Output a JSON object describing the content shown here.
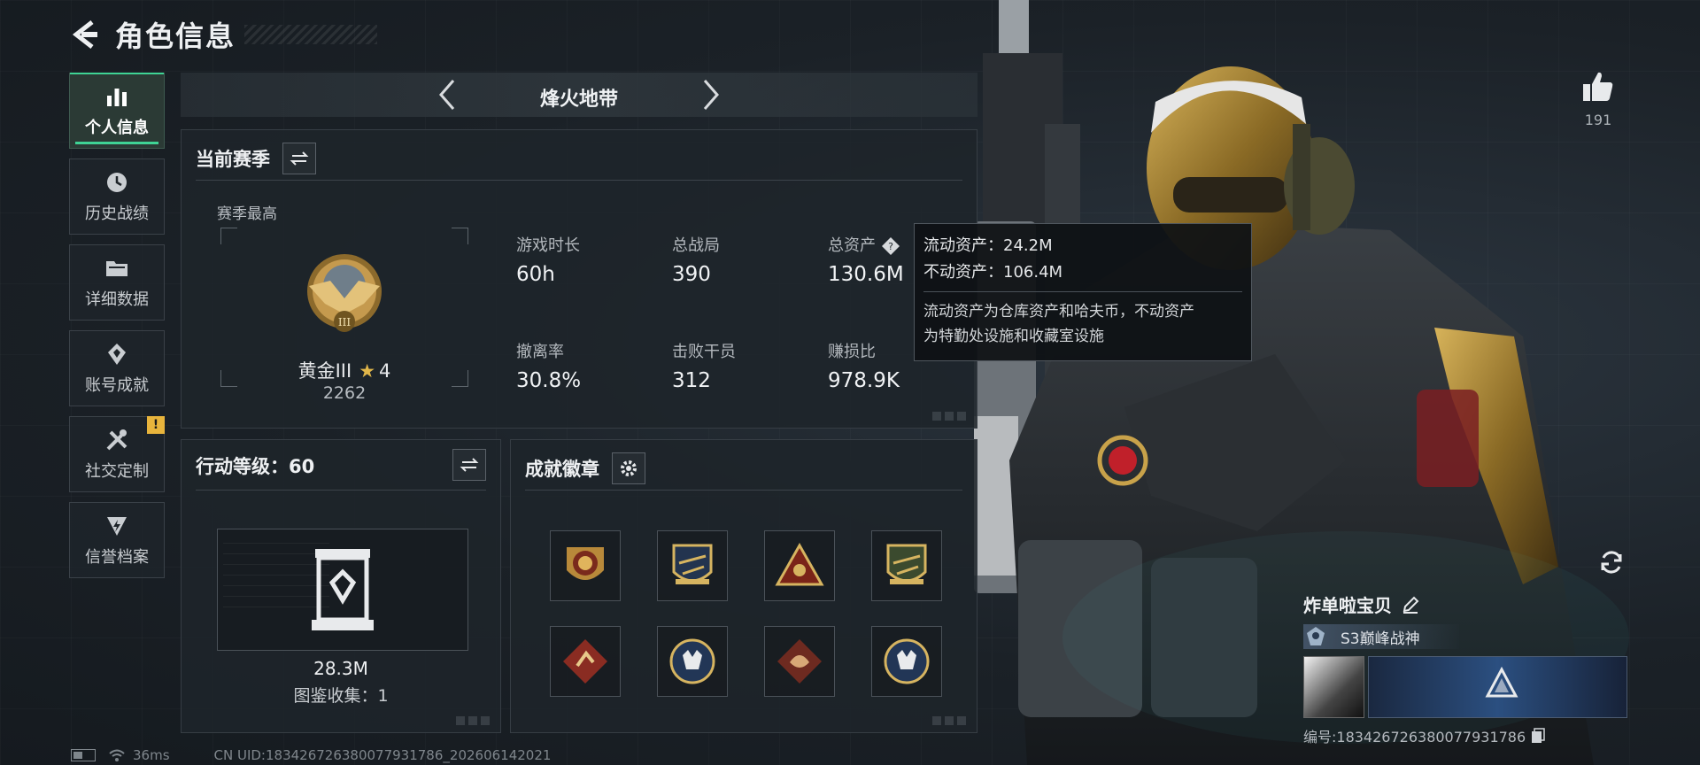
{
  "header": {
    "title": "角色信息"
  },
  "sidebar": {
    "items": [
      {
        "label": "个人信息",
        "icon": "bar-chart-icon",
        "active": true
      },
      {
        "label": "历史战绩",
        "icon": "history-icon"
      },
      {
        "label": "详细数据",
        "icon": "folder-icon"
      },
      {
        "label": "账号成就",
        "icon": "achievement-icon"
      },
      {
        "label": "社交定制",
        "icon": "tools-icon",
        "badge": "!"
      },
      {
        "label": "信誉档案",
        "icon": "credit-icon"
      }
    ]
  },
  "mode": {
    "title": "烽火地带"
  },
  "season": {
    "title": "当前赛季",
    "best_label": "赛季最高",
    "rank_name": "黄金III",
    "rank_star": "★",
    "rank_stars": "4",
    "rank_score": "2262",
    "stats": [
      {
        "label": "游戏时长",
        "value": "60h"
      },
      {
        "label": "总战局",
        "value": "390"
      },
      {
        "label": "总资产",
        "value": "130.6M"
      },
      {
        "label": "撤离率",
        "value": "30.8%"
      },
      {
        "label": "击败干员",
        "value": "312"
      },
      {
        "label": "赚损比",
        "value": "978.9K"
      }
    ]
  },
  "tooltip": {
    "liquid": "流动资产：24.2M",
    "fixed": "不动资产：106.4M",
    "desc_line1": "流动资产为仓库资产和哈夫币，不动资产",
    "desc_line2": "为特勤处设施和收藏室设施"
  },
  "level": {
    "title": "行动等级：60",
    "value": "28.3M",
    "collect": "图鉴收集：1"
  },
  "badges": {
    "title": "成就徽章",
    "count": 8
  },
  "profile": {
    "like_count": "191",
    "name": "炸单啦宝贝",
    "title": "S3巅峰战神",
    "uid_line": "编号:1834267263800779317​86"
  },
  "status": {
    "ping": "36ms",
    "uid_full": "CN UID:1834267263800779317​86_202606142021"
  },
  "colors": {
    "accent": "#3fd495",
    "gold": "#e0b64a",
    "warning": "#e8b43c"
  }
}
